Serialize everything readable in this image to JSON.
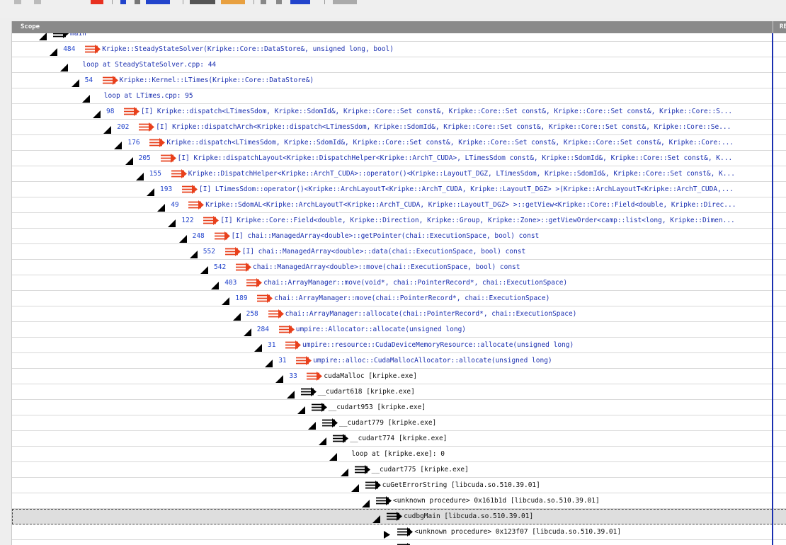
{
  "header": {
    "scope_label": "Scope",
    "second_col_label": "RE"
  },
  "colors": {
    "link": "#1a2fb0",
    "number": "#2244cc",
    "arrow_red": "#e8401c",
    "arrow_black": "#000000"
  },
  "rows": [
    {
      "indent": 0,
      "tri": "expanded",
      "number": "",
      "arrow": "black",
      "label": "main",
      "link": true
    },
    {
      "indent": 1,
      "tri": "expanded",
      "number": "484",
      "arrow": "red",
      "label": "Kripke::SteadyStateSolver(Kripke::Core::DataStore&, unsigned long, bool)",
      "link": true
    },
    {
      "indent": 2,
      "tri": "expanded",
      "number": "",
      "arrow": "none",
      "label": "loop at SteadyStateSolver.cpp: 44",
      "link": true
    },
    {
      "indent": 3,
      "tri": "expanded",
      "number": "54",
      "arrow": "red",
      "label": "Kripke::Kernel::LTimes(Kripke::Core::DataStore&)",
      "link": true
    },
    {
      "indent": 4,
      "tri": "expanded",
      "number": "",
      "arrow": "none",
      "label": "loop at LTimes.cpp: 95",
      "link": true
    },
    {
      "indent": 5,
      "tri": "expanded",
      "number": "98",
      "arrow": "red",
      "label": "[I] Kripke::dispatch<LTimesSdom, Kripke::SdomId&, Kripke::Core::Set const&, Kripke::Core::Set const&, Kripke::Core::Set const&, Kripke::Core::S...",
      "link": true
    },
    {
      "indent": 6,
      "tri": "expanded",
      "number": "202",
      "arrow": "red",
      "label": "[I] Kripke::dispatchArch<Kripke::dispatch<LTimesSdom, Kripke::SdomId&, Kripke::Core::Set const&, Kripke::Core::Set const&, Kripke::Core::Se...",
      "link": true
    },
    {
      "indent": 7,
      "tri": "expanded",
      "number": "176",
      "arrow": "red",
      "label": "Kripke::dispatch<LTimesSdom, Kripke::SdomId&, Kripke::Core::Set const&, Kripke::Core::Set const&, Kripke::Core::Set const&, Kripke::Core:...",
      "link": true
    },
    {
      "indent": 8,
      "tri": "expanded",
      "number": "205",
      "arrow": "red",
      "label": "[I] Kripke::dispatchLayout<Kripke::DispatchHelper<Kripke::ArchT_CUDA>, LTimesSdom const&, Kripke::SdomId&, Kripke::Core::Set const&, K...",
      "link": true
    },
    {
      "indent": 9,
      "tri": "expanded",
      "number": "155",
      "arrow": "red",
      "label": "Kripke::DispatchHelper<Kripke::ArchT_CUDA>::operator()<Kripke::LayoutT_DGZ, LTimesSdom, Kripke::SdomId&, Kripke::Core::Set const&, K...",
      "link": true
    },
    {
      "indent": 10,
      "tri": "expanded",
      "number": "193",
      "arrow": "red",
      "label": "[I] LTimesSdom::operator()<Kripke::ArchLayoutT<Kripke::ArchT_CUDA, Kripke::LayoutT_DGZ> >(Kripke::ArchLayoutT<Kripke::ArchT_CUDA,...",
      "link": true
    },
    {
      "indent": 11,
      "tri": "expanded",
      "number": "49",
      "arrow": "red",
      "label": "Kripke::SdomAL<Kripke::ArchLayoutT<Kripke::ArchT_CUDA, Kripke::LayoutT_DGZ> >::getView<Kripke::Core::Field<double, Kripke::Direc...",
      "link": true
    },
    {
      "indent": 12,
      "tri": "expanded",
      "number": "122",
      "arrow": "red",
      "label": "[I] Kripke::Core::Field<double, Kripke::Direction, Kripke::Group, Kripke::Zone>::getViewOrder<camp::list<long, Kripke::Dimen...",
      "link": true
    },
    {
      "indent": 13,
      "tri": "expanded",
      "number": "248",
      "arrow": "red",
      "label": "[I] chai::ManagedArray<double>::getPointer(chai::ExecutionSpace, bool) const",
      "link": true
    },
    {
      "indent": 14,
      "tri": "expanded",
      "number": "552",
      "arrow": "red",
      "label": "[I] chai::ManagedArray<double>::data(chai::ExecutionSpace, bool) const",
      "link": true
    },
    {
      "indent": 15,
      "tri": "expanded",
      "number": "542",
      "arrow": "red",
      "label": "chai::ManagedArray<double>::move(chai::ExecutionSpace, bool) const",
      "link": true
    },
    {
      "indent": 16,
      "tri": "expanded",
      "number": "403",
      "arrow": "red",
      "label": "chai::ArrayManager::move(void*, chai::PointerRecord*, chai::ExecutionSpace)",
      "link": true
    },
    {
      "indent": 17,
      "tri": "expanded",
      "number": "189",
      "arrow": "red",
      "label": "chai::ArrayManager::move(chai::PointerRecord*, chai::ExecutionSpace)",
      "link": true
    },
    {
      "indent": 18,
      "tri": "expanded",
      "number": "258",
      "arrow": "red",
      "label": "chai::ArrayManager::allocate(chai::PointerRecord*, chai::ExecutionSpace)",
      "link": true
    },
    {
      "indent": 19,
      "tri": "expanded",
      "number": "284",
      "arrow": "red",
      "label": "umpire::Allocator::allocate(unsigned long)",
      "link": true
    },
    {
      "indent": 20,
      "tri": "expanded",
      "number": "31",
      "arrow": "red",
      "label": "umpire::resource::CudaDeviceMemoryResource::allocate(unsigned long)",
      "link": true
    },
    {
      "indent": 21,
      "tri": "expanded",
      "number": "31",
      "arrow": "red",
      "label": "umpire::alloc::CudaMallocAllocator::allocate(unsigned long)",
      "link": true
    },
    {
      "indent": 22,
      "tri": "expanded",
      "number": "33",
      "arrow": "red",
      "label": "cudaMalloc [kripke.exe]",
      "link": false
    },
    {
      "indent": 23,
      "tri": "expanded",
      "number": "",
      "arrow": "black",
      "label": "__cudart618 [kripke.exe]",
      "link": false
    },
    {
      "indent": 24,
      "tri": "expanded",
      "number": "",
      "arrow": "black",
      "label": "__cudart953 [kripke.exe]",
      "link": false
    },
    {
      "indent": 25,
      "tri": "expanded",
      "number": "",
      "arrow": "black",
      "label": "__cudart779 [kripke.exe]",
      "link": false
    },
    {
      "indent": 26,
      "tri": "expanded",
      "number": "",
      "arrow": "black",
      "label": "__cudart774 [kripke.exe]",
      "link": false
    },
    {
      "indent": 27,
      "tri": "expanded",
      "number": "",
      "arrow": "none",
      "label": "loop at [kripke.exe]: 0",
      "link": false
    },
    {
      "indent": 28,
      "tri": "expanded",
      "number": "",
      "arrow": "black",
      "label": "__cudart775 [kripke.exe]",
      "link": false
    },
    {
      "indent": 29,
      "tri": "expanded",
      "number": "",
      "arrow": "black",
      "label": "cuGetErrorString [libcuda.so.510.39.01]",
      "link": false
    },
    {
      "indent": 30,
      "tri": "expanded",
      "number": "",
      "arrow": "black",
      "label": "<unknown procedure> 0x161b1d [libcuda.so.510.39.01]",
      "link": false
    },
    {
      "indent": 31,
      "tri": "expanded",
      "number": "",
      "arrow": "black",
      "label": "cudbgMain [libcuda.so.510.39.01]",
      "link": false,
      "selected": true
    },
    {
      "indent": 32,
      "tri": "collapsed",
      "number": "",
      "arrow": "black",
      "label": "<unknown procedure> 0x123f07 [libcuda.so.510.39.01]",
      "link": false
    },
    {
      "indent": 32,
      "tri": "collapsed",
      "number": "",
      "arrow": "black",
      "label": "",
      "link": false
    }
  ]
}
